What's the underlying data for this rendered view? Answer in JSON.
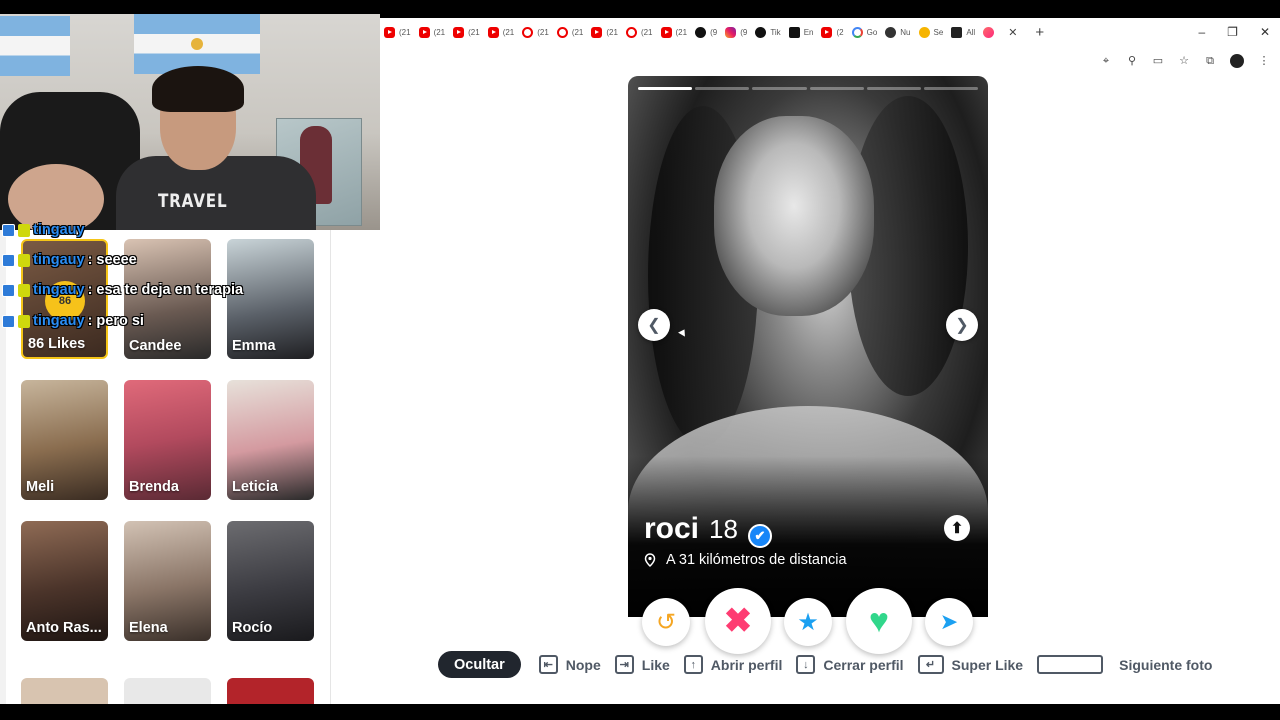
{
  "browser": {
    "tabs": [
      {
        "label": "(21",
        "icon": "youtube"
      },
      {
        "label": "(21",
        "icon": "youtube"
      },
      {
        "label": "(21",
        "icon": "youtube"
      },
      {
        "label": "(21",
        "icon": "youtube"
      },
      {
        "label": "(21",
        "icon": "youtube-ring"
      },
      {
        "label": "(21",
        "icon": "youtube-ring"
      },
      {
        "label": "(21",
        "icon": "youtube"
      },
      {
        "label": "(21",
        "icon": "youtube-ring"
      },
      {
        "label": "(21",
        "icon": "youtube"
      },
      {
        "label": "(9",
        "icon": "threads"
      },
      {
        "label": "(9",
        "icon": "instagram"
      },
      {
        "label": "Tik",
        "icon": "threads"
      },
      {
        "label": "En",
        "icon": "tiktok"
      },
      {
        "label": "(2",
        "icon": "youtube"
      },
      {
        "label": "Go",
        "icon": "google"
      },
      {
        "label": "Nu",
        "icon": "nu"
      },
      {
        "label": "Se",
        "icon": "se"
      },
      {
        "label": "All",
        "icon": "github"
      },
      {
        "label": "",
        "icon": "tinder",
        "active": true
      }
    ],
    "close_glyph": "✕",
    "new_tab_glyph": "+",
    "window_controls": [
      "–",
      "❐",
      "✕"
    ]
  },
  "chat": [
    {
      "user": "tingauy",
      "msg": ""
    },
    {
      "user": "tingauy",
      "msg": ": seeee"
    },
    {
      "user": "tingauy",
      "msg": ": esa te deja en terapia"
    },
    {
      "user": "tingauy",
      "msg": ": pero si"
    }
  ],
  "webcam": {
    "shirt_text": "TRAVEL"
  },
  "grid": {
    "likes": {
      "count": "86",
      "label": "86 Likes"
    },
    "cards": [
      {
        "name": "Candee",
        "dot": true
      },
      {
        "name": "Emma",
        "dot": true
      },
      {
        "name": "Meli",
        "dot": false
      },
      {
        "name": "Brenda",
        "dot": false
      },
      {
        "name": "Leticia",
        "dot": true
      },
      {
        "name": "Anto Ras...",
        "dot": true
      },
      {
        "name": "Elena",
        "dot": true
      },
      {
        "name": "Rocío",
        "dot": true
      }
    ]
  },
  "profile": {
    "name": "roci",
    "age": "18",
    "distance": "A 31 kilómetros de distancia",
    "photo_count": 6,
    "photo_index": 1,
    "verified": true
  },
  "actions": {
    "rewind": "↺",
    "nope": "✖",
    "super_like": "★",
    "like": "♥",
    "boost": "➤"
  },
  "hints": {
    "hide": "Ocultar",
    "nope": "Nope",
    "like": "Like",
    "open_profile": "Abrir perfil",
    "close_profile": "Cerrar perfil",
    "super_like": "Super Like",
    "next_photo": "Siguiente foto"
  },
  "colors": {
    "nope": "#fe3c72",
    "like": "#31d78b",
    "super_like": "#1ba0f1",
    "rewind": "#f5a623",
    "verified": "#1786f8",
    "dot": "#ea1c5a",
    "chat_user": "#2a8df4"
  }
}
